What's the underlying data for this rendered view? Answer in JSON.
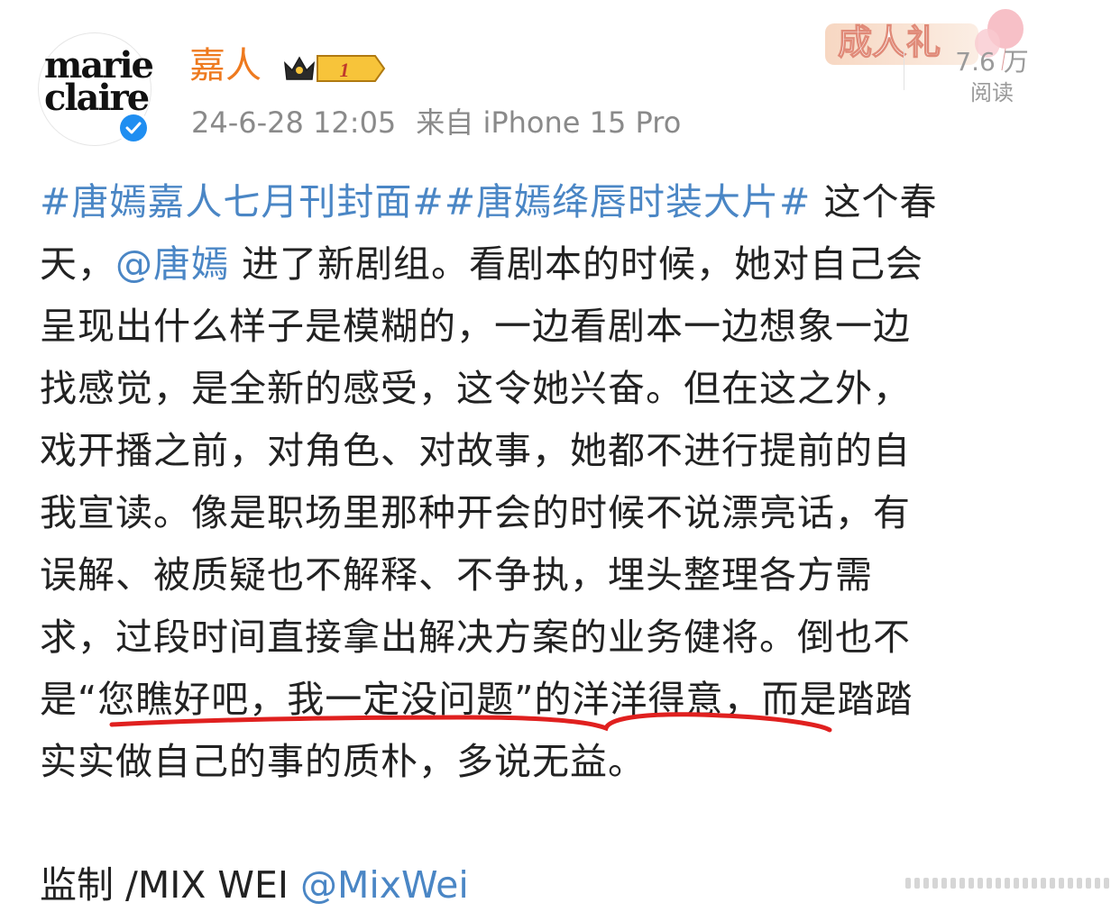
{
  "header": {
    "avatar_text_line1": "marie",
    "avatar_text_line2": "claire",
    "username": "嘉人",
    "vip_level": "1",
    "timestamp": "24-6-28 12:05",
    "source": "来自 iPhone 15 Pro",
    "banner_text": "成人礼",
    "views_count": "7.6 万",
    "views_label": "阅读"
  },
  "post": {
    "lines": [
      {
        "parts": [
          {
            "t": "#唐嫣嘉人七月刊封面##唐嫣绛唇时装大片#",
            "link": true
          },
          {
            "t": " 这个春",
            "link": false
          }
        ]
      },
      {
        "parts": [
          {
            "t": "天，",
            "link": false
          },
          {
            "t": "@唐嫣",
            "link": true
          },
          {
            "t": " 进了新剧组。看剧本的时候，她对自己会",
            "link": false
          }
        ]
      },
      {
        "parts": [
          {
            "t": "呈现出什么样子是模糊的，一边看剧本一边想象一边",
            "link": false
          }
        ]
      },
      {
        "parts": [
          {
            "t": "找感觉，是全新的感受，这令她兴奋。但在这之外，",
            "link": false
          }
        ]
      },
      {
        "parts": [
          {
            "t": "戏开播之前，对角色、对故事，她都不进行提前的自",
            "link": false
          }
        ]
      },
      {
        "parts": [
          {
            "t": "我宣读。像是职场里那种开会的时候不说漂亮话，有",
            "link": false
          }
        ]
      },
      {
        "parts": [
          {
            "t": "误解、被质疑也不解释、不争执，埋头整理各方需",
            "link": false
          }
        ]
      },
      {
        "parts": [
          {
            "t": "求，过段时间直接拿出解决方案的业务健将。倒也不",
            "link": false
          }
        ]
      },
      {
        "parts": [
          {
            "t": "是“您瞧好吧，我一定没问题”的洋洋得意，而是踏踏",
            "link": false
          }
        ]
      },
      {
        "parts": [
          {
            "t": "实实做自己的事的质朴，多说无益。",
            "link": false
          }
        ]
      }
    ],
    "credit_text": "监制 /MIX WEI ",
    "credit_mention": "@MixWei"
  },
  "colors": {
    "username": "#ee7a1f",
    "link": "#4a86c5",
    "meta": "#8a8a8a",
    "underline": "#e0201f",
    "verified": "#1f8ef1"
  },
  "icons": {
    "verified": "verified-check-icon",
    "vip": "crown-vip-icon",
    "more": "more-dots-icon"
  }
}
